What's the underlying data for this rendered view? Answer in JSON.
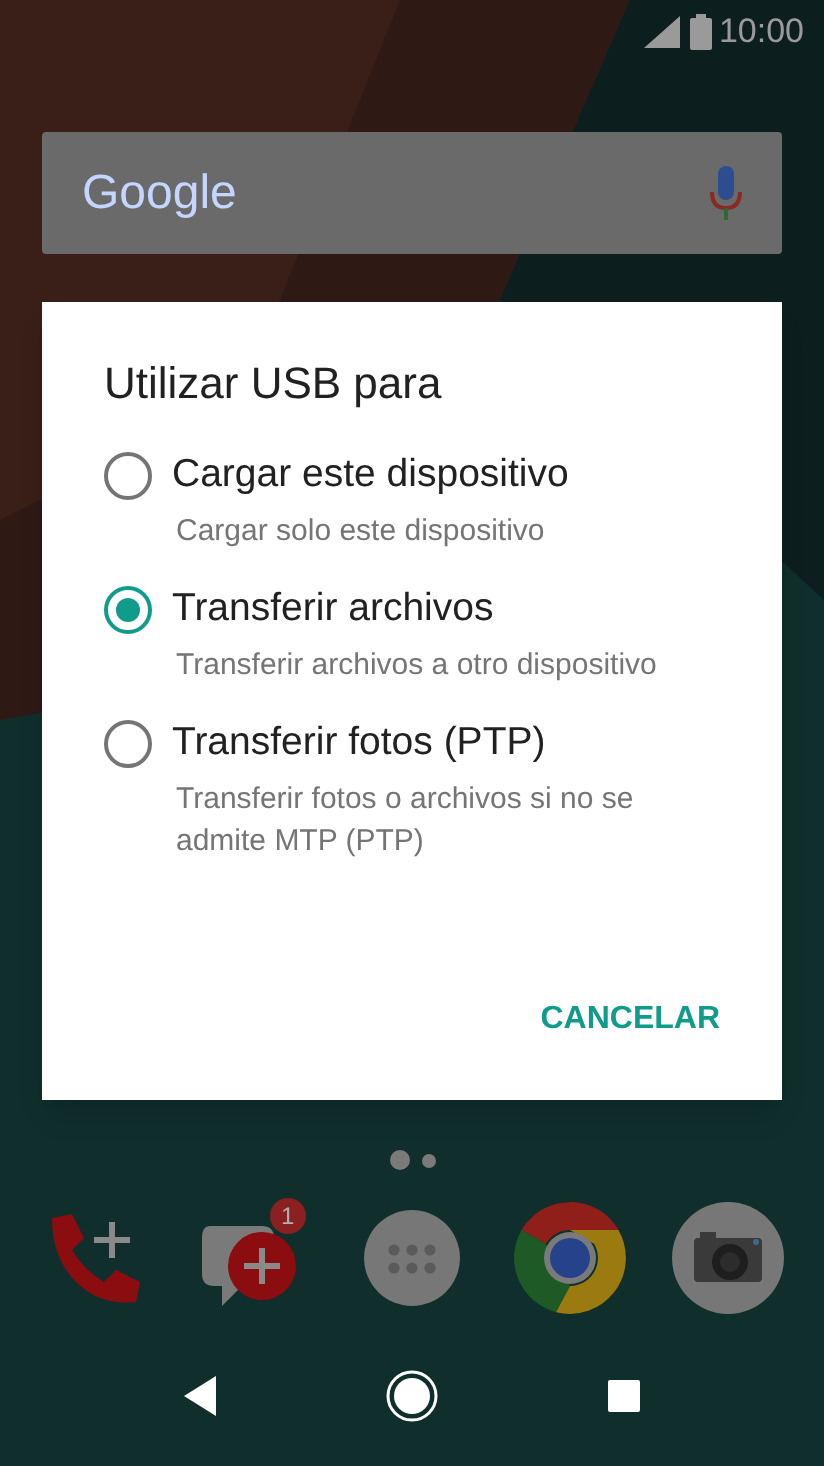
{
  "status_bar": {
    "time": "10:00"
  },
  "search_bar": {
    "logo": "Google"
  },
  "dialog": {
    "title": "Utilizar USB para",
    "options": [
      {
        "label": "Cargar este dispositivo",
        "description": "Cargar solo este dispositivo",
        "selected": false
      },
      {
        "label": "Transferir archivos",
        "description": "Transferir archivos a otro dispositivo",
        "selected": true
      },
      {
        "label": "Transferir fotos (PTP)",
        "description": "Transferir fotos o archivos si no se admite MTP (PTP)",
        "selected": false
      }
    ],
    "buttons": [
      "CANCELAR"
    ]
  },
  "page_indicator": [
    {
      "selected": true
    },
    {
      "selected": false
    }
  ],
  "dock": [
    {
      "kind": "phone"
    },
    {
      "kind": "messages",
      "badge": "1"
    },
    {
      "kind": "apps"
    },
    {
      "kind": "browser"
    },
    {
      "kind": "camera"
    }
  ]
}
